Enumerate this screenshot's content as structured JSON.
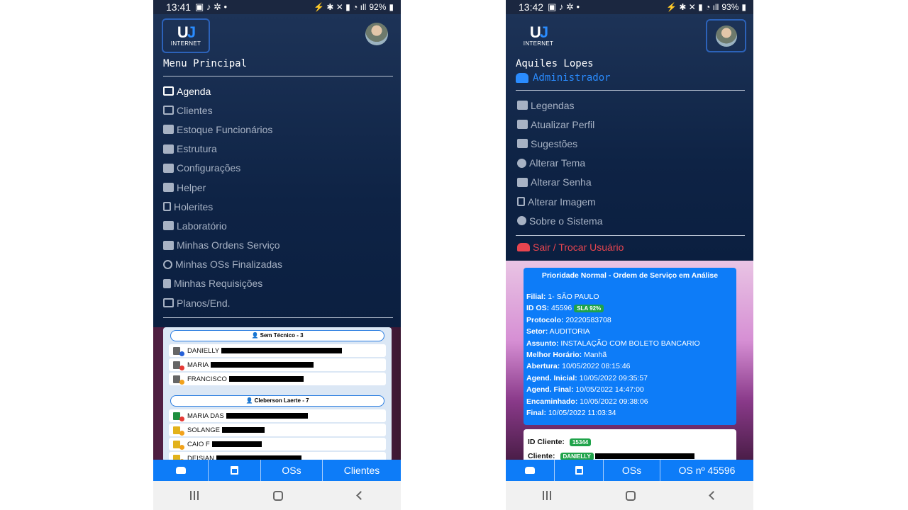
{
  "left": {
    "status": {
      "time": "13:41",
      "battery": "92%"
    },
    "logo_text": "INTERNET",
    "menu_title": "Menu Principal",
    "menu_items": [
      {
        "label": "Agenda",
        "active": true
      },
      {
        "label": "Clientes"
      },
      {
        "label": "Estoque Funcionários"
      },
      {
        "label": "Estrutura"
      },
      {
        "label": "Configurações"
      },
      {
        "label": "Helper"
      },
      {
        "label": "Holerites"
      },
      {
        "label": "Laboratório"
      },
      {
        "label": "Minhas Ordens Serviço"
      },
      {
        "label": "Minhas OSs Finalizadas"
      },
      {
        "label": "Minhas Requisições"
      },
      {
        "label": "Planos/End."
      }
    ],
    "groups": [
      {
        "title": "Sem Técnico - 3",
        "rows": [
          {
            "name": "DANIELLY",
            "icon": "gray",
            "dot": "blue"
          },
          {
            "name": "MARIA",
            "icon": "gray",
            "dot": "red"
          },
          {
            "name": "FRANCISCO",
            "icon": "gray",
            "dot": "orange"
          }
        ]
      },
      {
        "title": "Cleberson Laerte - 7",
        "rows": [
          {
            "name": "MARIA DAS",
            "icon": "green",
            "dot": "red"
          },
          {
            "name": "SOLANGE",
            "icon": "yellow",
            "dot": "orange"
          },
          {
            "name": "CAIO F",
            "icon": "yellow",
            "dot": "orange"
          },
          {
            "name": "DEISIAN",
            "icon": "yellow",
            "dot": "orange"
          }
        ]
      }
    ],
    "bottom_tabs": [
      "",
      "",
      "OSs",
      "Clientes"
    ]
  },
  "right": {
    "status": {
      "time": "13:42",
      "battery": "93%"
    },
    "logo_text": "INTERNET",
    "user_name": "Aquiles Lopes",
    "user_role": "Administrador",
    "menu_items": [
      "Legendas",
      "Atualizar Perfil",
      "Sugestões",
      "Alterar Tema",
      "Alterar Senha",
      "Alterar Imagem",
      "Sobre o Sistema"
    ],
    "logout_label": "Sair / Trocar Usuário",
    "os_card": {
      "title": "Prioridade Normal - Ordem de Serviço em Análise",
      "fields": [
        {
          "k": "Filial:",
          "v": " 1- SÃO PAULO"
        },
        {
          "k": "ID OS:",
          "v": " 45596",
          "badge": "SLA 92%"
        },
        {
          "k": "Protocolo:",
          "v": " 20220583708"
        },
        {
          "k": "Setor:",
          "v": " AUDITORIA"
        },
        {
          "k": "Assunto:",
          "v": " INSTALAÇÃO COM BOLETO BANCARIO"
        },
        {
          "k": "Melhor Horário:",
          "v": " Manhã"
        },
        {
          "k": "Abertura:",
          "v": " 10/05/2022 08:15:46"
        },
        {
          "k": "Agend. Inicial:",
          "v": " 10/05/2022 09:35:57"
        },
        {
          "k": "Agend. Final:",
          "v": " 10/05/2022 14:47:00"
        },
        {
          "k": "Encaminhado:",
          "v": " 10/05/2022 09:38:06"
        },
        {
          "k": "Final:",
          "v": " 10/05/2022 11:03:34"
        }
      ]
    },
    "client_card": {
      "id_label": "ID Cliente:",
      "id_value": "15344",
      "client_label": "Cliente:",
      "client_value": "DANIELLY"
    },
    "bottom_tabs": [
      "",
      "",
      "OSs",
      "OS nº 45596"
    ]
  }
}
